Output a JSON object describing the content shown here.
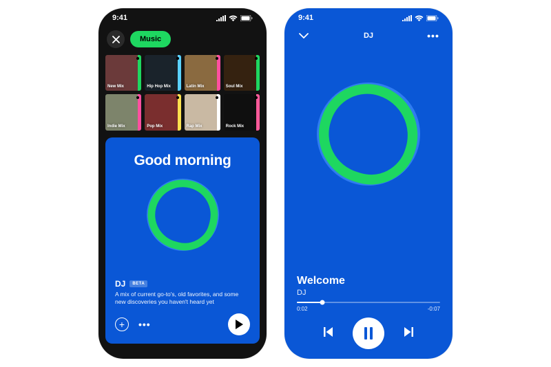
{
  "status": {
    "time": "9:41"
  },
  "left_phone": {
    "chip_label": "Music",
    "mixes": [
      {
        "label": "New Mix",
        "bg": "#6b3a3a",
        "stripe": "#1ed760"
      },
      {
        "label": "Hip Hop Mix",
        "bg": "#1a232b",
        "stripe": "#5ad1ff"
      },
      {
        "label": "Latin Mix",
        "bg": "#8a6a40",
        "stripe": "#ff4fa0"
      },
      {
        "label": "Soul Mix",
        "bg": "#352210",
        "stripe": "#1ed760"
      },
      {
        "label": "Indie Mix",
        "bg": "#7d846b",
        "stripe": "#ff4fa0"
      },
      {
        "label": "Pop Mix",
        "bg": "#7a2e2e",
        "stripe": "#ffe14f"
      },
      {
        "label": "Rap Mix",
        "bg": "#c9b9a3",
        "stripe": "#ffffff"
      },
      {
        "label": "Rock Mix",
        "bg": "#0f0f0f",
        "stripe": "#ff5a9a"
      }
    ],
    "card": {
      "greeting": "Good morning",
      "title": "DJ",
      "badge": "BETA",
      "description": "A mix of current go-to's, old favorites, and some new discoveries you haven't heard yet"
    }
  },
  "right_phone": {
    "header_title": "DJ",
    "track": {
      "title": "Welcome",
      "artist": "DJ"
    },
    "progress": {
      "elapsed": "0:02",
      "remaining": "-0:07"
    }
  }
}
